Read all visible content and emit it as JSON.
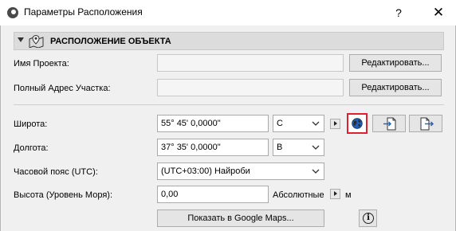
{
  "window": {
    "title": "Параметры Расположения",
    "help_label": "?",
    "close_label": "✕"
  },
  "section": {
    "title": "РАСПОЛОЖЕНИЕ ОБЪЕКТА"
  },
  "project": {
    "project_name_label": "Имя Проекта:",
    "project_name_value": "",
    "full_address_label": "Полный Адрес Участка:",
    "full_address_value": "",
    "edit_label": "Редактировать..."
  },
  "location": {
    "latitude_label": "Широта:",
    "latitude_value": "55° 45' 0,0000\"",
    "latitude_hemisphere": "С",
    "longitude_label": "Долгота:",
    "longitude_value": "37° 35' 0,0000\"",
    "longitude_hemisphere": "В",
    "timezone_label": "Часовой пояс (UTC):",
    "timezone_value": "(UTC+03:00) Найроби",
    "altitude_label": "Высота (Уровень Моря):",
    "altitude_value": "0,00",
    "altitude_reference": "Абсолютные",
    "altitude_unit": "м",
    "google_maps_button": "Показать в Google Maps...",
    "info_label": "i"
  },
  "icons": {
    "globe": "globe-icon",
    "import": "import-file-icon",
    "export": "export-file-icon",
    "map_pin": "map-pin-icon"
  },
  "colors": {
    "highlight_border": "#e0202a",
    "globe_blue": "#1f5fb4"
  }
}
